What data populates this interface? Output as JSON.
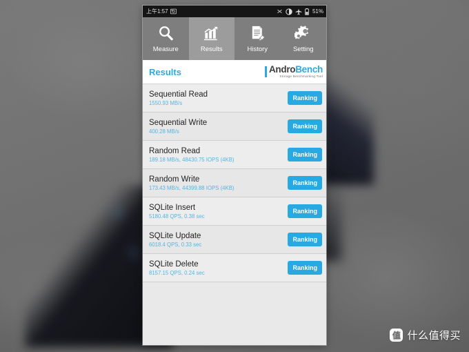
{
  "status_bar": {
    "time": "上午1:57",
    "left_icons": [
      "screenshot-icon"
    ],
    "right_icons": [
      "bluetooth-off-icon",
      "do-not-disturb-icon",
      "airplane-mode-icon",
      "battery-icon"
    ],
    "battery_percent": "51%"
  },
  "tabs": [
    {
      "label": "Measure",
      "icon": "search-icon",
      "selected": false
    },
    {
      "label": "Results",
      "icon": "bar-chart-icon",
      "selected": true
    },
    {
      "label": "History",
      "icon": "document-pen-icon",
      "selected": false
    },
    {
      "label": "Setting",
      "icon": "gears-icon",
      "selected": false
    }
  ],
  "header": {
    "title": "Results",
    "logo_primary": "Andro",
    "logo_secondary": "Bench",
    "logo_tagline": "Storage Benchmarking Tool"
  },
  "results": [
    {
      "name": "Sequential Read",
      "value": "1550.93 MB/s",
      "button": "Ranking"
    },
    {
      "name": "Sequential Write",
      "value": "400.28 MB/s",
      "button": "Ranking"
    },
    {
      "name": "Random Read",
      "value": "189.18 MB/s, 48430.75 IOPS (4KB)",
      "button": "Ranking"
    },
    {
      "name": "Random Write",
      "value": "173.43 MB/s, 44399.88 IOPS (4KB)",
      "button": "Ranking"
    },
    {
      "name": "SQLite Insert",
      "value": "5180.48 QPS, 0.38 sec",
      "button": "Ranking"
    },
    {
      "name": "SQLite Update",
      "value": "6018.4 QPS, 0.33 sec",
      "button": "Ranking"
    },
    {
      "name": "SQLite Delete",
      "value": "8157.15 QPS, 0.24 sec",
      "button": "Ranking"
    }
  ],
  "watermark": {
    "badge": "值",
    "text": "什么值得买"
  },
  "colors": {
    "accent_blue": "#29a9e1",
    "value_blue": "#56b4e2",
    "tab_bar": "#7e7e7e",
    "tab_selected": "#9c9c9c",
    "row_bg": "#ededed",
    "status_bar": "#151515"
  }
}
